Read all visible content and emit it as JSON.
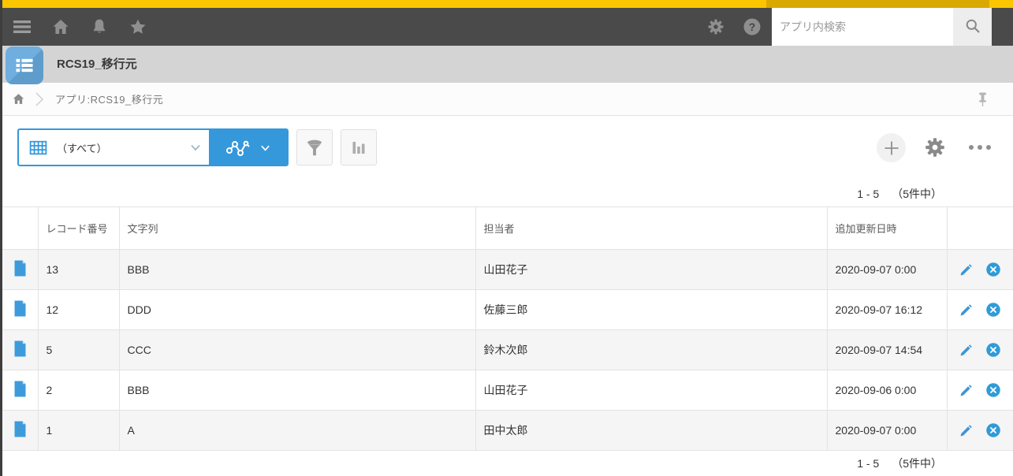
{
  "colors": {
    "brand_yellow": "#FBC600",
    "brand_yellow_dark": "#D9A900",
    "nav_bg": "#4A4A4A",
    "band_bg": "#D4D4D4",
    "accent_blue": "#3598DB",
    "row_alt_bg": "#F5F5F6",
    "border": "#E3E3E3"
  },
  "nav": {
    "search_placeholder": "アプリ内検索"
  },
  "app_header": {
    "title": "RCS19_移行元"
  },
  "breadcrumb": {
    "label": "アプリ:RCS19_移行元"
  },
  "toolbar": {
    "view_label": "（すべて）"
  },
  "pagination": {
    "range": "1 - 5",
    "total": "（5件中）"
  },
  "table": {
    "headers": {
      "record_no": "レコード番号",
      "text": "文字列",
      "assignee": "担当者",
      "datetime": "追加更新日時"
    },
    "rows": [
      {
        "record_no": "13",
        "text": "BBB",
        "assignee": "山田花子",
        "datetime": "2020-09-07 0:00"
      },
      {
        "record_no": "12",
        "text": "DDD",
        "assignee": "佐藤三郎",
        "datetime": "2020-09-07 16:12"
      },
      {
        "record_no": "5",
        "text": "CCC",
        "assignee": "鈴木次郎",
        "datetime": "2020-09-07 14:54"
      },
      {
        "record_no": "2",
        "text": "BBB",
        "assignee": "山田花子",
        "datetime": "2020-09-06 0:00"
      },
      {
        "record_no": "1",
        "text": "A",
        "assignee": "田中太郎",
        "datetime": "2020-09-07 0:00"
      }
    ]
  }
}
